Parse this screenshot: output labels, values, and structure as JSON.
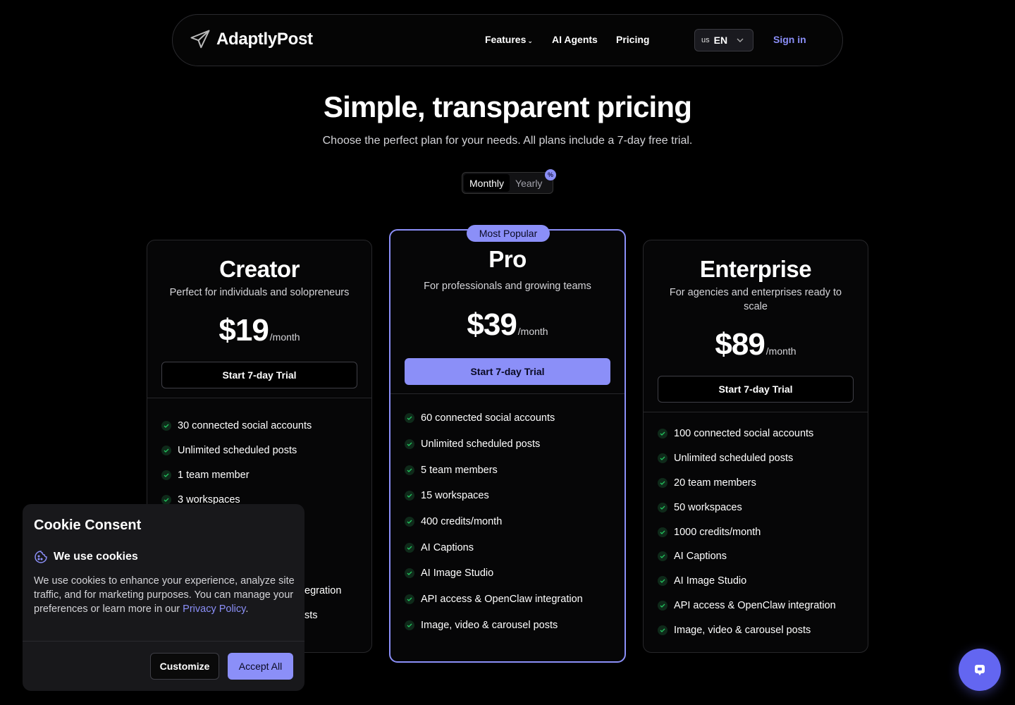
{
  "nav": {
    "brand": "AdaptlyPost",
    "links": [
      "Features",
      "AI Agents",
      "Pricing"
    ],
    "lang_flag": "us",
    "lang_code": "EN",
    "signin": "Sign in"
  },
  "hero": {
    "title": "Simple, transparent pricing",
    "subtitle": "Choose the perfect plan for your needs. All plans include a 7-day free trial."
  },
  "billing_toggle": {
    "options": [
      "Monthly",
      "Yearly"
    ],
    "selected": "Monthly",
    "badge": "%"
  },
  "plans": [
    {
      "name": "Creator",
      "desc": "Perfect for individuals and solopreneurs",
      "price": "$19",
      "period": "/month",
      "cta": "Start 7-day Trial",
      "features": [
        "30 connected social accounts",
        "Unlimited scheduled posts",
        "1 team member",
        "3 workspaces",
        "egration",
        "sts"
      ]
    },
    {
      "name": "Pro",
      "badge": "Most Popular",
      "desc": "For professionals and growing teams",
      "price": "$39",
      "period": "/month",
      "cta": "Start 7-day Trial",
      "features": [
        "60 connected social accounts",
        "Unlimited scheduled posts",
        "5 team members",
        "15 workspaces",
        "400 credits/month",
        "AI Captions",
        "AI Image Studio",
        "API access & OpenClaw integration",
        "Image, video & carousel posts"
      ]
    },
    {
      "name": "Enterprise",
      "desc": "For agencies and enterprises ready to scale",
      "price": "$89",
      "period": "/month",
      "cta": "Start 7-day Trial",
      "features": [
        "100 connected social accounts",
        "Unlimited scheduled posts",
        "20 team members",
        "50 workspaces",
        "1000 credits/month",
        "AI Captions",
        "AI Image Studio",
        "API access & OpenClaw integration",
        "Image, video & carousel posts"
      ]
    }
  ],
  "cookie": {
    "title": "Cookie Consent",
    "subtitle": "We use cookies",
    "body": "We use cookies to enhance your experience, analyze site traffic, and for marketing purposes. You can manage your preferences or learn more in our ",
    "link": "Privacy Policy",
    "period": ".",
    "customize": "Customize",
    "accept": "Accept All"
  },
  "colors": {
    "accent": "#8b8ff8",
    "background": "#000000",
    "check": "#22c55e"
  }
}
